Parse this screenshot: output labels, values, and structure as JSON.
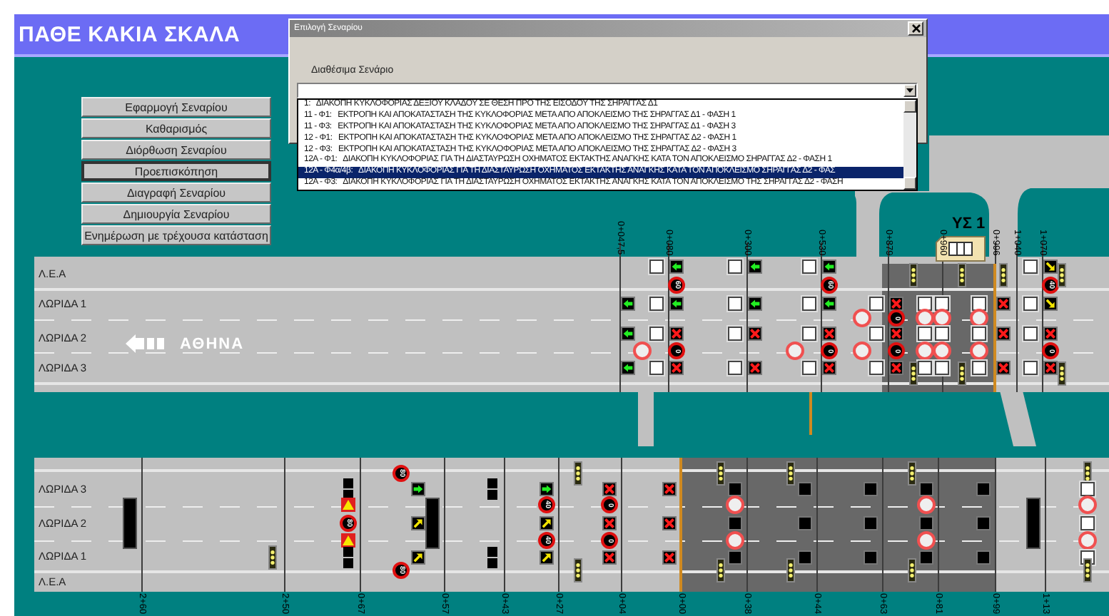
{
  "title": "ΠΑΘΕ ΚΑΚΙΑ ΣΚΑΛΑ",
  "menu_buttons": [
    {
      "label": "Εφαρμογή Σεναρίου",
      "selected": false
    },
    {
      "label": "Καθαρισμός",
      "selected": false
    },
    {
      "label": "Διόρθωση Σεναρίου",
      "selected": false
    },
    {
      "label": "Προεπισκόπηση",
      "selected": true
    },
    {
      "label": "Διαγραφή Σεναρίου",
      "selected": false
    },
    {
      "label": "Δημιουργία Σεναρίου",
      "selected": false
    },
    {
      "label": "Ενημέρωση με τρέχουσα κατάσταση",
      "selected": false
    }
  ],
  "dialog": {
    "title": "Επιλογή Σεναρίου",
    "field_label": "Διαθέσιμα Σενάριο",
    "scenarios": [
      {
        "label": "1:   ΔΙΑΚΟΠΗ ΚΥΚΛΟΦΟΡΙΑΣ ΔΕΞΙΟΥ ΚΛΑΔΟΥ ΣΕ ΘΕΣΗ ΠΡΟ ΤΗΣ ΕΙΣΟΔΟΥ ΤΗΣ ΣΗΡΑΓΓΑΣ Δ1",
        "selected": false
      },
      {
        "label": "11 - Φ1:   ΕΚΤΡΟΠΗ ΚΑΙ ΑΠΟΚΑΤΑΣΤΑΣΗ ΤΗΣ ΚΥΚΛΟΦΟΡΙΑΣ ΜΕΤΑ ΑΠΟ ΑΠΟΚΛΕΙΣΜΟ ΤΗΣ ΣΗΡΑΓΓΑΣ Δ1 - ΦΑΣΗ 1",
        "selected": false
      },
      {
        "label": "11 - Φ3:   ΕΚΤΡΟΠΗ ΚΑΙ ΑΠΟΚΑΤΑΣΤΑΣΗ ΤΗΣ ΚΥΚΛΟΦΟΡΙΑΣ ΜΕΤΑ ΑΠΟ ΑΠΟΚΛΕΙΣΜΟ ΤΗΣ ΣΗΡΑΓΓΑΣ Δ1 - ΦΑΣΗ 3",
        "selected": false
      },
      {
        "label": "12 - Φ1:   ΕΚΤΡΟΠΗ ΚΑΙ ΑΠΟΚΑΤΑΣΤΑΣΗ ΤΗΣ ΚΥΚΛΟΦΟΡΙΑΣ ΜΕΤΑ ΑΠΟ ΑΠΟΚΛΕΙΣΜΟ ΤΗΣ ΣΗΡΑΓΓΑΣ Δ2 - ΦΑΣΗ 1",
        "selected": false
      },
      {
        "label": "12 - Φ3:   ΕΚΤΡΟΠΗ ΚΑΙ ΑΠΟΚΑΤΑΣΤΑΣΗ ΤΗΣ ΚΥΚΛΟΦΟΡΙΑΣ ΜΕΤΑ ΑΠΟ ΑΠΟΚΛΕΙΣΜΟ ΤΗΣ ΣΗΡΑΓΓΑΣ Δ2 - ΦΑΣΗ 3",
        "selected": false
      },
      {
        "label": "12Α - Φ1:   ΔΙΑΚΟΠΗ ΚΥΚΛΟΦΟΡΙΑΣ ΓΙΑ ΤΗ ΔΙΑΣΤΑΥΡΩΣΗ ΟΧΗΜΑΤΟΣ ΕΚΤΑΚΤΗΣ ΑΝΑΓΚΗΣ ΚΑΤΑ ΤΟΝ ΑΠΟΚΛΕΙΣΜΟ ΣΗΡΑΓΓΑΣ Δ2 - ΦΑΣΗ 1",
        "selected": false
      },
      {
        "label": "12Α - Φ4α/4β:   ΔΙΑΚΟΠΗ ΚΥΚΛΟΦΟΡΙΑΣ ΓΙΑ ΤΗ ΔΙΑΣΤΑΥΡΩΣΗ ΟΧΗΜΑΤΟΣ ΕΚΤΑΚΤΗΣ ΑΝΑΓΚΗΣ ΚΑΤΑ ΤΟΝ ΑΠΟΚΛΕΙΣΜΟ ΣΗΡΑΓΓΑΣ Δ2 - ΦΑΣ",
        "selected": true
      },
      {
        "label": "12Α - Φ3:   ΔΙΑΚΟΠΗ ΚΥΚΛΟΦΟΡΙΑΣ ΓΙΑ ΤΗ ΔΙΑΣΤΑΥΡΩΣΗ ΟΧΗΜΑΤΟΣ ΕΚΤΑΚΤΗΣ ΑΝΑΓΚΗΣ ΚΑΤΑ ΤΟΝ ΑΠΟΚΛΕΙΣΜΟ ΤΗΣ ΣΗΡΑΓΓΑΣ Δ2 - ΦΑΣΗ",
        "selected": false
      }
    ]
  },
  "upper_road": {
    "lanes": [
      "Λ.Ε.Α",
      "ΛΩΡΙΔΑ 1",
      "ΛΩΡΙΔΑ 2",
      "ΛΩΡΙΔΑ 3"
    ],
    "direction": "ΑΘΗΝΑ",
    "building": "ΥΣ 1",
    "gantries": [
      {
        "station": "0+047,5",
        "after": {
          "lane_1": {
            "kind": "arrow-left"
          },
          "lane_2": {
            "kind": "arrow-left"
          },
          "lane_3": {
            "kind": "arrow-left"
          }
        }
      },
      {
        "station": "0+080",
        "before": {
          "shoulder": {
            "kind": "blank"
          },
          "lane_1": {
            "kind": "blank"
          },
          "lane_2": {
            "kind": "blank"
          },
          "lane_3": {
            "kind": "blank"
          }
        },
        "far_before": {
          "line_2_3": {
            "kind": "closed"
          }
        },
        "after": {
          "shoulder": {
            "kind": "arrow-left"
          },
          "line_shoulder_1": {
            "kind": "speed",
            "text": "60"
          },
          "lane_1": {
            "kind": "arrow-left"
          },
          "lane_2": {
            "kind": "cross"
          },
          "line_2_3": {
            "kind": "speed",
            "text": "0"
          },
          "lane_3": {
            "kind": "cross"
          }
        }
      },
      {
        "station": "0+300",
        "before": {
          "shoulder": {
            "kind": "blank"
          },
          "lane_1": {
            "kind": "blank"
          },
          "lane_2": {
            "kind": "blank"
          },
          "lane_3": {
            "kind": "blank"
          }
        },
        "after": {
          "shoulder": {
            "kind": "arrow-left"
          },
          "lane_1": {
            "kind": "arrow-left"
          },
          "lane_2": {
            "kind": "cross"
          },
          "lane_3": {
            "kind": "cross"
          }
        }
      },
      {
        "station": "0+530",
        "before": {
          "shoulder": {
            "kind": "blank"
          },
          "lane_1": {
            "kind": "blank"
          },
          "lane_2": {
            "kind": "blank"
          },
          "lane_3": {
            "kind": "blank"
          }
        },
        "far_before": {
          "line_2_3": {
            "kind": "closed"
          }
        },
        "after": {
          "shoulder": {
            "kind": "arrow-left"
          },
          "line_shoulder_1": {
            "kind": "speed",
            "text": "60"
          },
          "lane_1": {
            "kind": "arrow-left"
          },
          "lane_2": {
            "kind": "cross"
          },
          "line_2_3": {
            "kind": "speed",
            "text": "0"
          },
          "lane_3": {
            "kind": "cross"
          }
        }
      },
      {
        "station": "0+879",
        "before": {
          "lane_1": {
            "kind": "blank"
          },
          "lane_2": {
            "kind": "blank"
          },
          "lane_3": {
            "kind": "blank"
          }
        },
        "far_before": {
          "line_1_2": {
            "kind": "closed"
          },
          "line_2_3": {
            "kind": "closed"
          }
        },
        "after": {
          "lane_1": {
            "kind": "cross"
          },
          "line_1_2": {
            "kind": "speed",
            "text": "0"
          },
          "lane_2": {
            "kind": "cross"
          },
          "line_2_3": {
            "kind": "speed",
            "text": "0"
          },
          "lane_3": {
            "kind": "cross"
          }
        }
      },
      {
        "before": {
          "top": {
            "kind": "lights"
          },
          "bottom": {
            "kind": "lights"
          }
        },
        "center": {
          "lane_1": {
            "kind": "blank"
          },
          "line_1_2": {
            "kind": "closed"
          },
          "lane_2": {
            "kind": "blank"
          },
          "line_2_3": {
            "kind": "closed"
          },
          "lane_3": {
            "kind": "blank"
          }
        }
      },
      {
        "station": "0+960",
        "center": {
          "lane_1": {
            "kind": "blank"
          },
          "line_1_2": {
            "kind": "closed"
          },
          "lane_2": {
            "kind": "blank"
          },
          "line_2_3": {
            "kind": "closed"
          },
          "lane_3": {
            "kind": "blank"
          }
        },
        "far_after": {
          "top": {
            "kind": "lights"
          },
          "bottom": {
            "kind": "lights"
          }
        }
      },
      {
        "center": {
          "lane_1": {
            "kind": "blank"
          },
          "line_1_2": {
            "kind": "closed"
          },
          "lane_2": {
            "kind": "blank"
          },
          "line_2_3": {
            "kind": "closed"
          },
          "lane_3": {
            "kind": "blank"
          }
        }
      },
      {
        "station": "0+996",
        "after": {
          "top": {
            "kind": "lights"
          },
          "lane_1": {
            "kind": "cross"
          },
          "lane_2": {
            "kind": "cross"
          },
          "lane_3": {
            "kind": "cross"
          }
        }
      },
      {
        "station": "1+040"
      },
      {
        "station": "1+070",
        "before": {
          "shoulder": {
            "kind": "blank"
          },
          "lane_1": {
            "kind": "blank"
          },
          "lane_2": {
            "kind": "blank"
          },
          "lane_3": {
            "kind": "blank"
          }
        },
        "after": {
          "shoulder": {
            "kind": "diagonal-down"
          },
          "line_shoulder_1": {
            "kind": "speed",
            "text": "40"
          },
          "lane_1": {
            "kind": "diagonal-down"
          },
          "lane_2": {
            "kind": "cross"
          },
          "line_2_3": {
            "kind": "speed",
            "text": "0"
          },
          "lane_3": {
            "kind": "cross"
          }
        },
        "far_after": {
          "top": {
            "kind": "lights"
          },
          "bottom": {
            "kind": "lights"
          }
        }
      }
    ]
  },
  "lower_road": {
    "lanes": [
      "ΛΩΡΙΔΑ 3",
      "ΛΩΡΙΔΑ 2",
      "ΛΩΡΙΔΑ 1",
      "Λ.Ε.Α"
    ],
    "gantries": [
      {
        "station": "2+60",
        "before": {
          "lane_2": {
            "kind": "vms"
          }
        }
      },
      {
        "station": "2+50",
        "before": {
          "lane_1": {
            "kind": "lights"
          }
        }
      },
      {
        "station": "0+67",
        "before": {
          "lane_3": {
            "kind": "signal-pair"
          },
          "line_3_2": {
            "kind": "warning"
          },
          "lane_2": {
            "kind": "speed",
            "text": "80"
          },
          "line_2_1": {
            "kind": "warning"
          },
          "lane_1": {
            "kind": "signal-pair"
          }
        }
      },
      {
        "station": "0+57",
        "farthest_before": {
          "top": {
            "kind": "speed",
            "text": "80"
          },
          "bottom": {
            "kind": "speed",
            "text": "80"
          }
        },
        "far_before": {
          "lane_3": {
            "kind": "arrow-right"
          },
          "lane_2": {
            "kind": "diagonal-up"
          },
          "lane_1": {
            "kind": "diagonal-up"
          }
        },
        "before": {
          "lane_2": {
            "kind": "vms"
          }
        }
      },
      {
        "station": "0+43",
        "before": {
          "lane_3": {
            "kind": "signal-pair"
          },
          "lane_1": {
            "kind": "signal-pair"
          }
        }
      },
      {
        "station": "0+27",
        "before": {
          "lane_3": {
            "kind": "arrow-right"
          },
          "line_3_2": {
            "kind": "speed",
            "text": "40"
          },
          "lane_2": {
            "kind": "diagonal-up"
          },
          "line_2_1": {
            "kind": "speed",
            "text": "40"
          },
          "lane_1": {
            "kind": "diagonal-up"
          }
        },
        "far_after": {
          "top": {
            "kind": "lights"
          },
          "bottom": {
            "kind": "lights"
          }
        }
      },
      {
        "station": "0+04",
        "before": {
          "lane_3": {
            "kind": "cross"
          },
          "line_3_2": {
            "kind": "speed",
            "text": "0"
          },
          "lane_2": {
            "kind": "cross"
          },
          "line_2_1": {
            "kind": "speed",
            "text": "0"
          },
          "lane_1": {
            "kind": "cross"
          }
        }
      },
      {
        "station": "0+00",
        "before": {
          "lane_3": {
            "kind": "cross"
          },
          "lane_2": {
            "kind": "cross"
          },
          "lane_1": {
            "kind": "cross"
          }
        }
      },
      {
        "station": "0+38",
        "far_before": {
          "top": {
            "kind": "lights"
          },
          "bottom": {
            "kind": "lights"
          }
        },
        "before": {
          "lane_3": {
            "kind": "dark"
          },
          "line_3_2": {
            "kind": "closed"
          },
          "lane_2": {
            "kind": "dark"
          },
          "line_2_1": {
            "kind": "closed"
          },
          "lane_1": {
            "kind": "dark"
          }
        }
      },
      {
        "station": "0+44",
        "far_before": {
          "top": {
            "kind": "lights"
          },
          "bottom": {
            "kind": "lights"
          }
        },
        "before": {
          "lane_3": {
            "kind": "dark"
          },
          "lane_2": {
            "kind": "dark"
          },
          "lane_1": {
            "kind": "dark"
          }
        }
      },
      {
        "station": "0+63",
        "before": {
          "lane_3": {
            "kind": "dark"
          },
          "lane_2": {
            "kind": "dark"
          },
          "lane_1": {
            "kind": "dark"
          }
        }
      },
      {
        "station": "0+81",
        "far_before": {
          "top": {
            "kind": "lights"
          },
          "bottom": {
            "kind": "lights"
          }
        },
        "before": {
          "lane_3": {
            "kind": "dark"
          },
          "line_3_2": {
            "kind": "closed"
          },
          "lane_2": {
            "kind": "dark"
          },
          "line_2_1": {
            "kind": "closed"
          },
          "lane_1": {
            "kind": "dark"
          }
        }
      },
      {
        "station": "0+99",
        "before": {
          "lane_3": {
            "kind": "dark"
          },
          "lane_2": {
            "kind": "dark"
          },
          "lane_1": {
            "kind": "dark"
          }
        }
      },
      {
        "station": "1+13",
        "before": {
          "lane_2": {
            "kind": "vms"
          }
        },
        "farthest_after": {
          "top": {
            "kind": "lights"
          },
          "lane_3": {
            "kind": "blank"
          },
          "line_3_2": {
            "kind": "closed"
          },
          "lane_2": {
            "kind": "blank"
          },
          "line_2_1": {
            "kind": "closed"
          },
          "lane_1": {
            "kind": "blank"
          },
          "bottom": {
            "kind": "lights"
          }
        }
      }
    ]
  }
}
